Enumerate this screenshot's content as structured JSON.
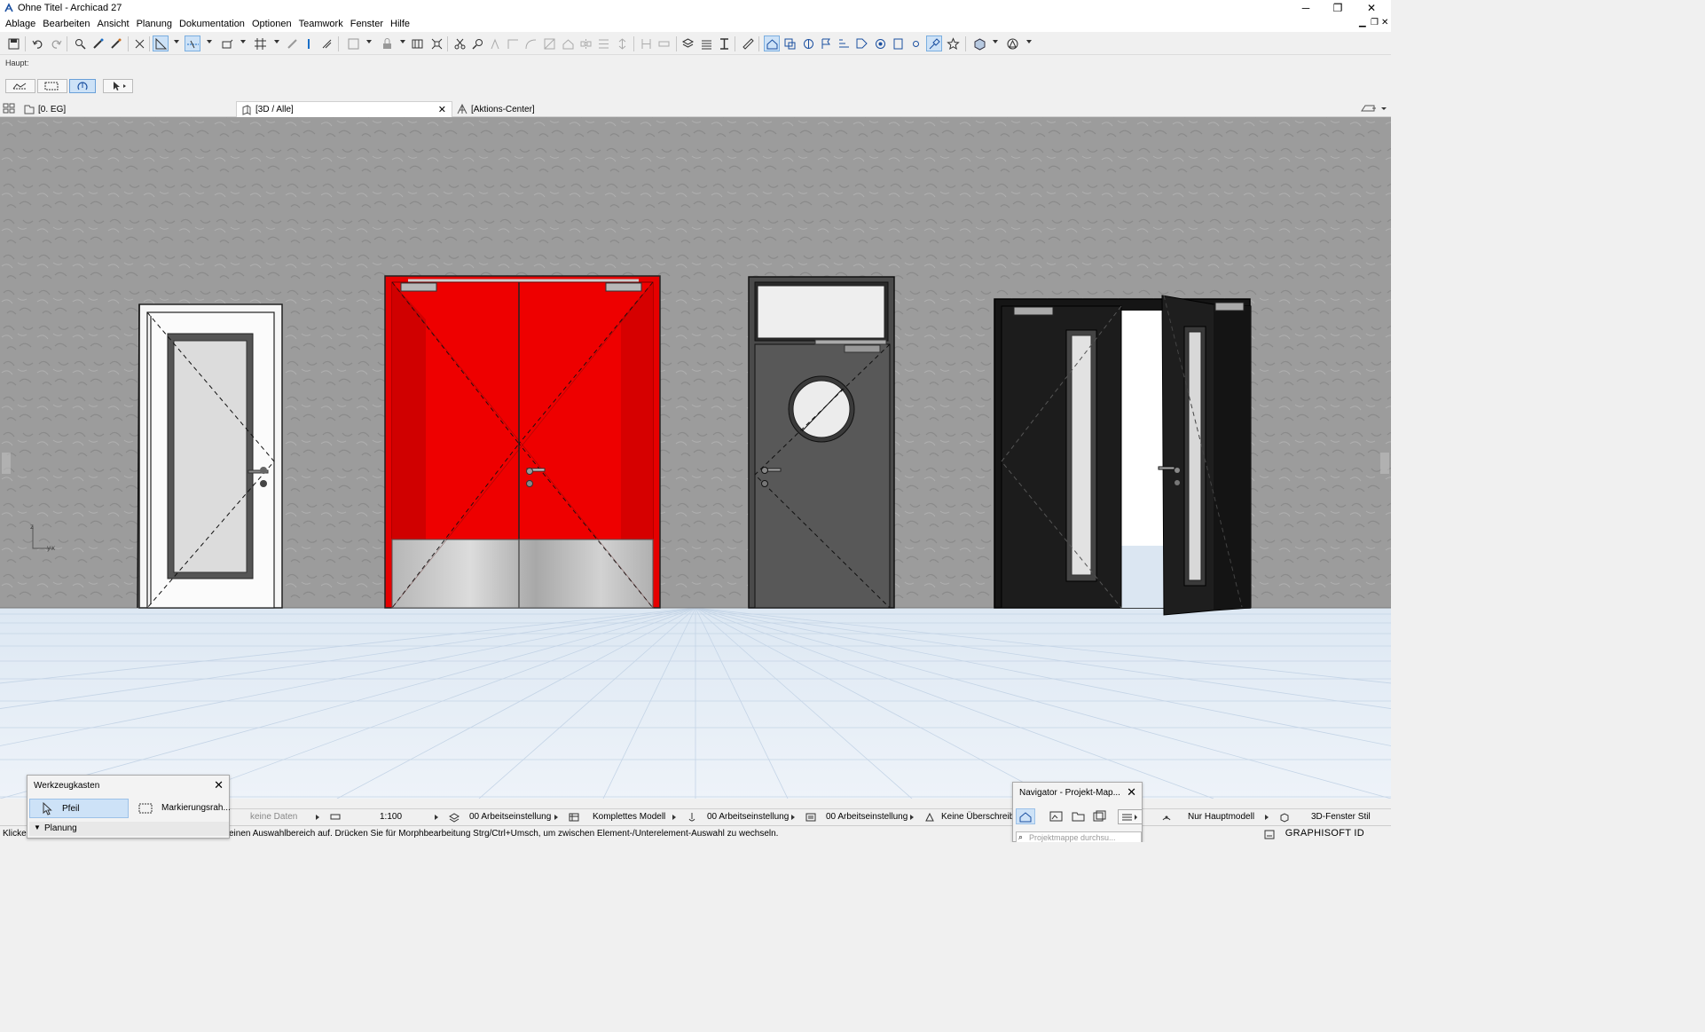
{
  "window": {
    "title": "Ohne Titel - Archicad 27",
    "minimize_glyph": "─",
    "restore_glyph": "❐",
    "close_glyph": "✕"
  },
  "menu": [
    "Ablage",
    "Bearbeiten",
    "Ansicht",
    "Planung",
    "Dokumentation",
    "Optionen",
    "Teamwork",
    "Fenster",
    "Hilfe"
  ],
  "infobox": {
    "label": "Haupt:"
  },
  "tabs": {
    "floorplan": "[0. EG]",
    "view3d": "[3D / Alle]",
    "close": "✕",
    "action_center": "[Aktions-Center]"
  },
  "viewport": {
    "axis_z": "z",
    "axis_yx": "y",
    "axis_x": "x",
    "wall_color": "#9c9c9c",
    "floor_color": "#e4edf6",
    "red_door_color": "#e60000"
  },
  "toolbox_palette": {
    "title": "Werkzeugkasten",
    "close": "✕",
    "tool_arrow": "Pfeil",
    "tool_marquee": "Markierungsrah...",
    "section": "Planung"
  },
  "navigator_palette": {
    "title": "Navigator - Projekt-Map...",
    "close": "✕",
    "search_placeholder": "Projektmappe durchsu..."
  },
  "viewbar": {
    "no_data": "keine Daten",
    "scale": "1:100",
    "layers": "00 Arbeitseinstellung",
    "model": "Komplettes Modell",
    "pen_set": "00 Arbeitseinstellung",
    "mvo": "00 Arbeitseinstellung",
    "override": "Keine Überschreibu",
    "main_model": "Nur Hauptmodell",
    "window_style": "3D-Fenster Stil"
  },
  "status": {
    "left_fragment": "Klicker",
    "message": "einen Auswahlbereich auf. Drücken Sie für Morphbearbeitung Strg/Ctrl+Umsch, um zwischen Element-/Unterelement-Auswahl zu wechseln.",
    "brand": "GRAPHISOFT ID"
  }
}
